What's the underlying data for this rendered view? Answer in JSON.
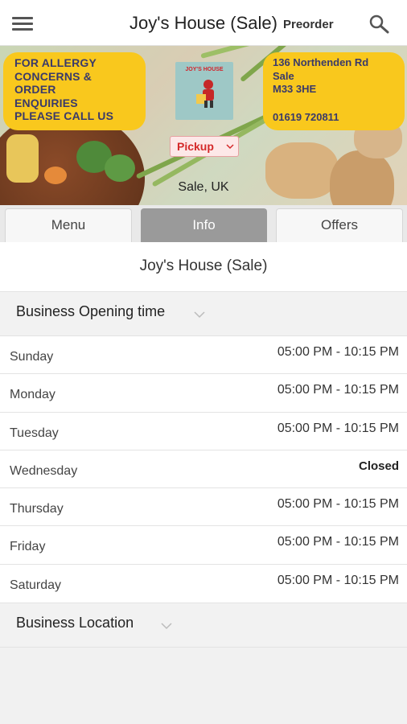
{
  "header": {
    "title": "Joy's House (Sale)",
    "preorder_label": "Preorder",
    "menu_icon": "hamburger-menu-icon",
    "search_icon": "search-icon"
  },
  "banner": {
    "allergy_lines": [
      "FOR ALLERGY",
      "CONCERNS &",
      "ORDER",
      "ENQUIRIES",
      "PLEASE CALL US"
    ],
    "address_lines": [
      "136 Northenden Rd",
      "Sale",
      "M33 3HE"
    ],
    "phone": "01619 720811",
    "logo_text": "JOY'S HOUSE",
    "order_type": "Pickup",
    "locality": "Sale, UK",
    "accent_color": "#f9c81d"
  },
  "tabs": [
    {
      "label": "Menu",
      "active": false
    },
    {
      "label": "Info",
      "active": true
    },
    {
      "label": "Offers",
      "active": false
    }
  ],
  "info": {
    "restaurant_name": "Joy's House (Sale)",
    "opening_section_title": "Business Opening time",
    "hours": [
      {
        "day": "Sunday",
        "time": "05:00 PM - 10:15 PM"
      },
      {
        "day": "Monday",
        "time": "05:00 PM - 10:15 PM"
      },
      {
        "day": "Tuesday",
        "time": "05:00 PM - 10:15 PM"
      },
      {
        "day": "Wednesday",
        "time": "Closed"
      },
      {
        "day": "Thursday",
        "time": "05:00 PM - 10:15 PM"
      },
      {
        "day": "Friday",
        "time": "05:00 PM - 10:15 PM"
      },
      {
        "day": "Saturday",
        "time": "05:00 PM - 10:15 PM"
      }
    ],
    "location_section_title": "Business Location"
  }
}
